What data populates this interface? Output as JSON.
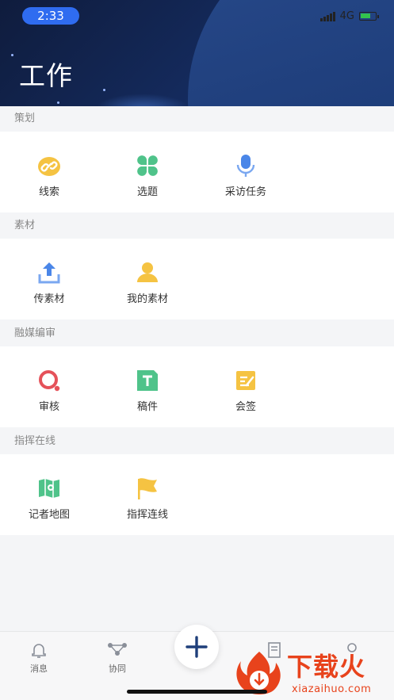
{
  "status_bar": {
    "time": "2:33",
    "network": "4G"
  },
  "header": {
    "title": "工作"
  },
  "sections": [
    {
      "label": "策划",
      "items": [
        {
          "label": "线索",
          "icon": "link-icon"
        },
        {
          "label": "选题",
          "icon": "clover-icon"
        },
        {
          "label": "采访任务",
          "icon": "microphone-icon"
        }
      ]
    },
    {
      "label": "素材",
      "items": [
        {
          "label": "传素材",
          "icon": "upload-icon"
        },
        {
          "label": "我的素材",
          "icon": "person-icon"
        }
      ]
    },
    {
      "label": "融媒编审",
      "items": [
        {
          "label": "审核",
          "icon": "review-icon"
        },
        {
          "label": "稿件",
          "icon": "manuscript-icon"
        },
        {
          "label": "会签",
          "icon": "sign-icon"
        }
      ]
    },
    {
      "label": "指挥在线",
      "items": [
        {
          "label": "记者地图",
          "icon": "map-icon"
        },
        {
          "label": "指挥连线",
          "icon": "flag-icon"
        }
      ]
    }
  ],
  "tabbar": {
    "tabs": [
      {
        "label": "消息",
        "icon": "bell-icon"
      },
      {
        "label": "协同",
        "icon": "network-icon"
      }
    ]
  },
  "watermark": {
    "brand": "下载火",
    "domain": "xiazaihuo.com"
  },
  "colors": {
    "accent": "#2f6cf0",
    "header_dark": "#0f1c3d",
    "link_yellow": "#f5c342",
    "green": "#4fc38a",
    "blue": "#4a86e8",
    "red": "#e5525a",
    "watermark": "#e8431c"
  }
}
